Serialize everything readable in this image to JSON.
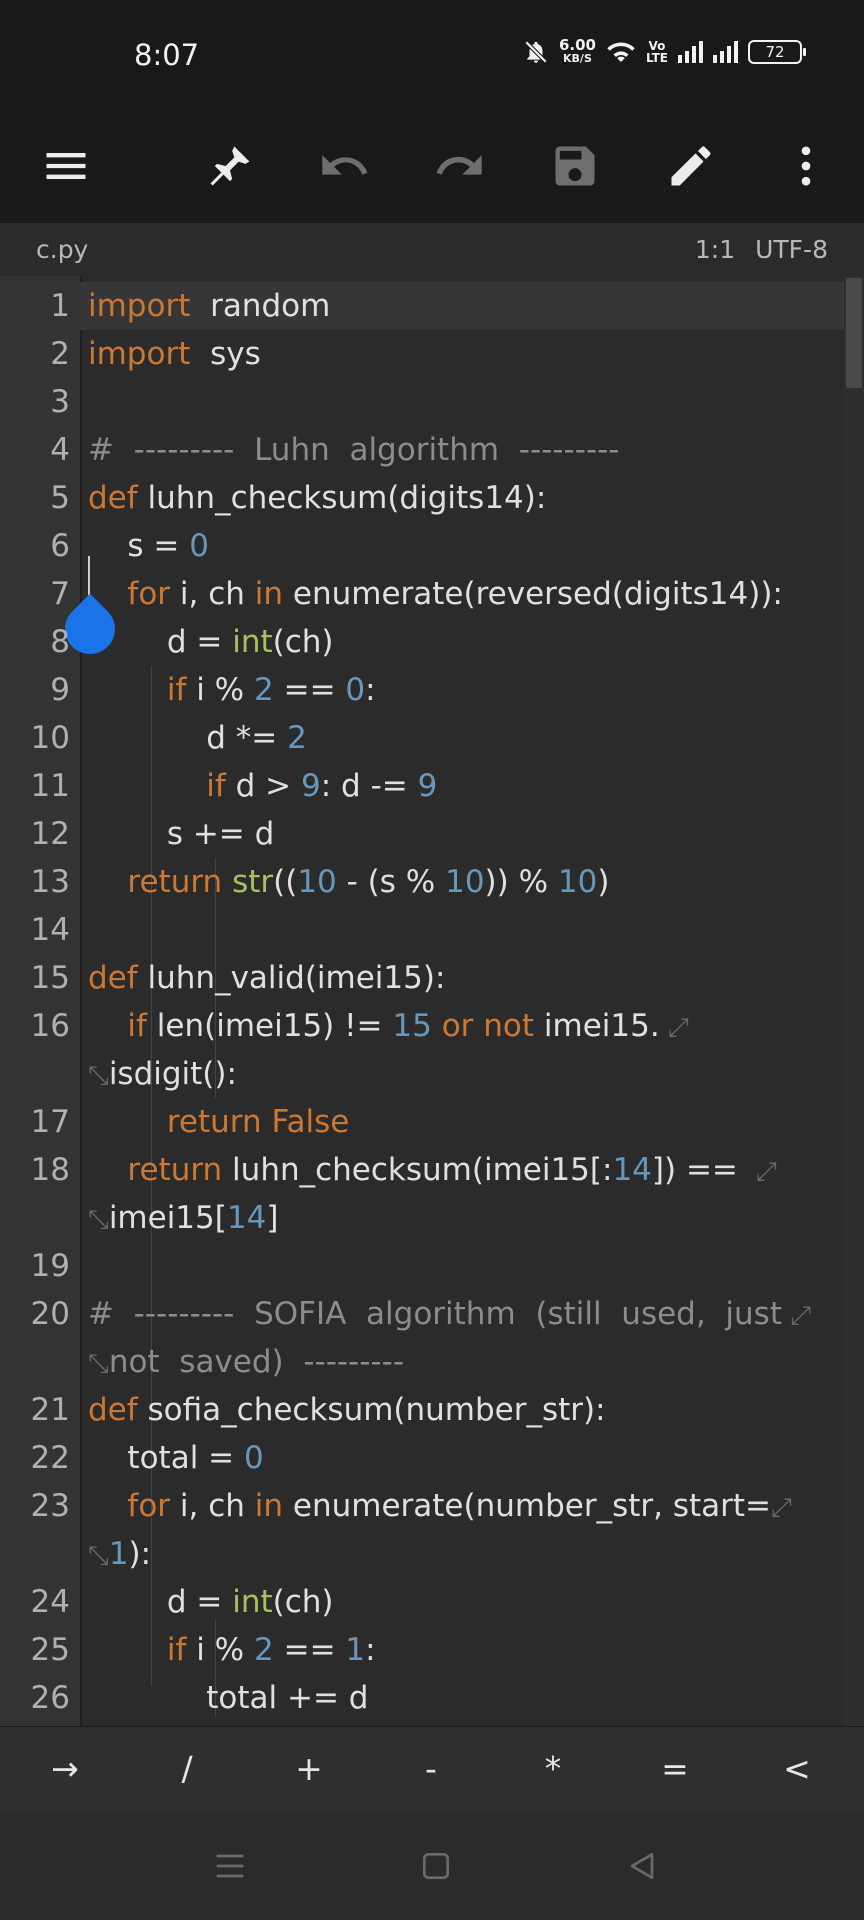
{
  "status": {
    "time": "8:07",
    "net_speed": "6.00",
    "net_unit": "KB/S",
    "volte_top": "Vo",
    "volte_bottom": "LTE",
    "battery": "72"
  },
  "toolbar": {
    "icons": [
      "menu-icon",
      "pin-icon",
      "undo-icon",
      "redo-icon",
      "save-icon",
      "edit-icon",
      "more-vert-icon"
    ]
  },
  "file": {
    "name": "c.py",
    "position": "1:1",
    "encoding": "UTF-8"
  },
  "editor": {
    "lines": [
      {
        "no": "1",
        "row": 0,
        "tokens": [
          [
            "kw",
            "import"
          ],
          [
            "",
            "  random"
          ]
        ]
      },
      {
        "no": "2",
        "row": 1,
        "tokens": [
          [
            "kw",
            "import"
          ],
          [
            "",
            "  sys"
          ]
        ]
      },
      {
        "no": "3",
        "row": 2,
        "tokens": []
      },
      {
        "no": "4",
        "row": 3,
        "tokens": [
          [
            "cm",
            "#  ---------  Luhn  algorithm  ---------"
          ]
        ]
      },
      {
        "no": "5",
        "row": 4,
        "tokens": [
          [
            "kw",
            "def"
          ],
          [
            "",
            " luhn_checksum(digits14):"
          ]
        ]
      },
      {
        "no": "6",
        "row": 5,
        "tokens": [
          [
            "",
            "    s = "
          ],
          [
            "num",
            "0"
          ]
        ]
      },
      {
        "no": "7",
        "row": 6,
        "tokens": [
          [
            "kw",
            "    for"
          ],
          [
            "",
            " i, ch "
          ],
          [
            "kw",
            "in"
          ],
          [
            "",
            " enumerate(reversed(digits14)):"
          ]
        ]
      },
      {
        "no": "8",
        "row": 7,
        "tokens": [
          [
            "",
            "        d = "
          ],
          [
            "bi",
            "int"
          ],
          [
            "",
            "(ch)"
          ]
        ]
      },
      {
        "no": "9",
        "row": 8,
        "tokens": [
          [
            "kw",
            "        if"
          ],
          [
            "",
            " i % "
          ],
          [
            "num",
            "2"
          ],
          [
            "",
            " == "
          ],
          [
            "num",
            "0"
          ],
          [
            "",
            ":"
          ]
        ]
      },
      {
        "no": "10",
        "row": 9,
        "tokens": [
          [
            "",
            "            d *= "
          ],
          [
            "num",
            "2"
          ]
        ]
      },
      {
        "no": "11",
        "row": 10,
        "tokens": [
          [
            "kw",
            "            if"
          ],
          [
            "",
            " d > "
          ],
          [
            "num",
            "9"
          ],
          [
            "",
            ": d -= "
          ],
          [
            "num",
            "9"
          ]
        ]
      },
      {
        "no": "12",
        "row": 11,
        "tokens": [
          [
            "",
            "        s += d"
          ]
        ]
      },
      {
        "no": "13",
        "row": 12,
        "tokens": [
          [
            "kw",
            "    return"
          ],
          [
            "",
            " "
          ],
          [
            "bi",
            "str"
          ],
          [
            "",
            "(("
          ],
          [
            "num",
            "10"
          ],
          [
            "",
            " - (s % "
          ],
          [
            "num",
            "10"
          ],
          [
            "",
            ")) % "
          ],
          [
            "num",
            "10"
          ],
          [
            "",
            ")"
          ]
        ]
      },
      {
        "no": "14",
        "row": 13,
        "tokens": []
      },
      {
        "no": "15",
        "row": 14,
        "tokens": [
          [
            "kw",
            "def"
          ],
          [
            "",
            " luhn_valid(imei15):"
          ]
        ]
      },
      {
        "no": "16",
        "row": 15,
        "tokens": [
          [
            "kw",
            "    if"
          ],
          [
            "",
            " len(imei15) != "
          ],
          [
            "num",
            "15"
          ],
          [
            "",
            " "
          ],
          [
            "kw",
            "or not"
          ],
          [
            "",
            " imei15."
          ],
          [
            "wrap",
            " ⤢"
          ]
        ]
      },
      {
        "no": "",
        "row": 16,
        "tokens": [
          [
            "wrap",
            "⤡"
          ],
          [
            "",
            "isdigit():"
          ]
        ]
      },
      {
        "no": "17",
        "row": 17,
        "tokens": [
          [
            "kw",
            "        return False"
          ]
        ]
      },
      {
        "no": "18",
        "row": 18,
        "tokens": [
          [
            "kw",
            "    return"
          ],
          [
            "",
            " luhn_checksum(imei15[:"
          ],
          [
            "num",
            "14"
          ],
          [
            "",
            "]) == "
          ],
          [
            "wrap",
            " ⤢"
          ]
        ]
      },
      {
        "no": "",
        "row": 19,
        "tokens": [
          [
            "wrap",
            "⤡"
          ],
          [
            "",
            "imei15["
          ],
          [
            "num",
            "14"
          ],
          [
            "",
            "]"
          ]
        ]
      },
      {
        "no": "19",
        "row": 20,
        "tokens": []
      },
      {
        "no": "20",
        "row": 21,
        "tokens": [
          [
            "cm",
            "#  ---------  SOFIA  algorithm  (still  used,  just"
          ],
          [
            "wrap",
            " ⤢"
          ]
        ]
      },
      {
        "no": "",
        "row": 22,
        "tokens": [
          [
            "wrap",
            "⤡"
          ],
          [
            "cm",
            "not  saved)  ---------"
          ]
        ]
      },
      {
        "no": "21",
        "row": 23,
        "tokens": [
          [
            "kw",
            "def"
          ],
          [
            "",
            " sofia_checksum(number_str):"
          ]
        ]
      },
      {
        "no": "22",
        "row": 24,
        "tokens": [
          [
            "",
            "    total = "
          ],
          [
            "num",
            "0"
          ]
        ]
      },
      {
        "no": "23",
        "row": 25,
        "tokens": [
          [
            "kw",
            "    for"
          ],
          [
            "",
            " i, ch "
          ],
          [
            "kw",
            "in"
          ],
          [
            "",
            " enumerate(number_str, start="
          ],
          [
            "wrap",
            "⤢"
          ]
        ]
      },
      {
        "no": "",
        "row": 26,
        "tokens": [
          [
            "wrap",
            "⤡"
          ],
          [
            "num",
            "1"
          ],
          [
            "",
            "):"
          ]
        ]
      },
      {
        "no": "24",
        "row": 27,
        "tokens": [
          [
            "",
            "        d = "
          ],
          [
            "bi",
            "int"
          ],
          [
            "",
            "(ch)"
          ]
        ]
      },
      {
        "no": "25",
        "row": 28,
        "tokens": [
          [
            "kw",
            "        if"
          ],
          [
            "",
            " i % "
          ],
          [
            "num",
            "2"
          ],
          [
            "",
            " == "
          ],
          [
            "num",
            "1"
          ],
          [
            "",
            ":"
          ]
        ]
      },
      {
        "no": "26",
        "row": 29,
        "tokens": [
          [
            "",
            "            total += d"
          ]
        ]
      }
    ]
  },
  "keybar": {
    "keys": [
      "→",
      "/",
      "+",
      "-",
      "*",
      "=",
      "<"
    ]
  }
}
